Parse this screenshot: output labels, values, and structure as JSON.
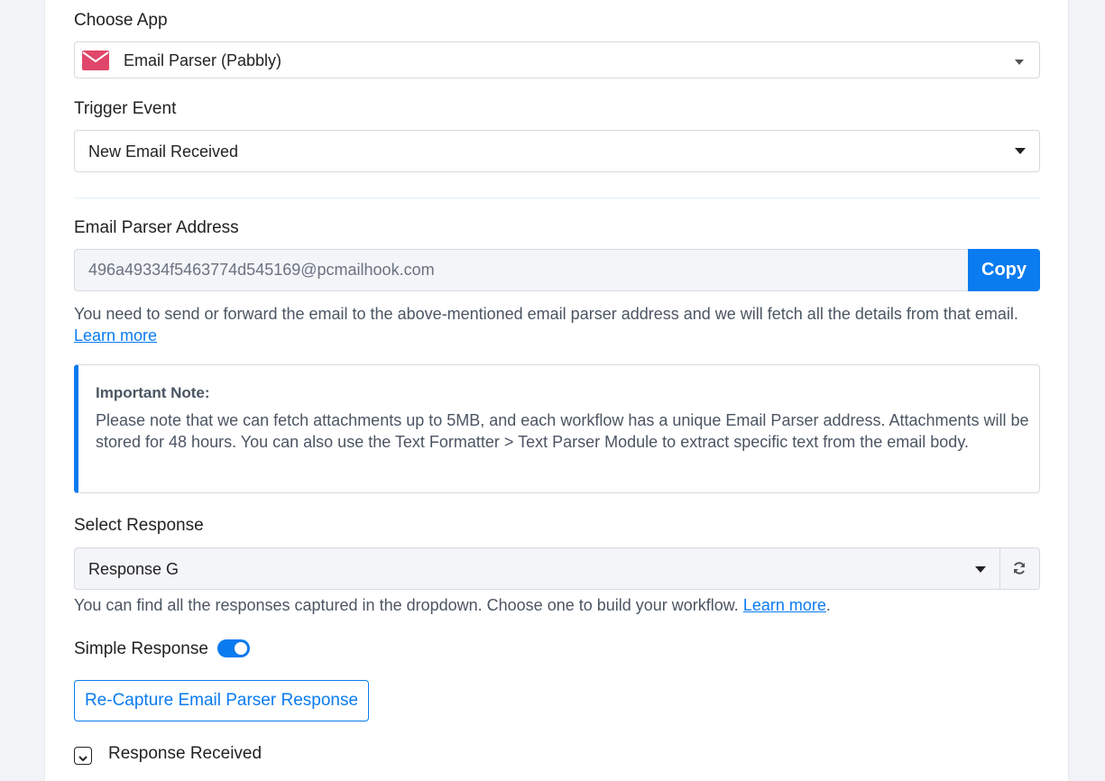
{
  "choose_app": {
    "label": "Choose App",
    "selected": "Email Parser (Pabbly)",
    "icon": "envelope-icon",
    "icon_color": "#e0476a"
  },
  "trigger_event": {
    "label": "Trigger Event",
    "selected": "New Email Received"
  },
  "email_parser_address": {
    "label": "Email Parser Address",
    "value": "496a49334f5463774d545169@pcmailhook.com",
    "copy_label": "Copy",
    "help_text": "You need to send or forward the email to the above-mentioned email parser address and we will fetch all the details from that email.",
    "learn_more": "Learn more"
  },
  "important_note": {
    "title": "Important Note:",
    "body": "Please note that we can fetch attachments up to 5MB, and each workflow has a unique Email Parser address. Attachments will be stored for 48 hours. You can also use the Text Formatter > Text Parser Module to extract specific text from the email body."
  },
  "select_response": {
    "label": "Select Response",
    "selected": "Response G",
    "help_text": "You can find all the responses captured in the dropdown. Choose one to build your workflow.",
    "learn_more": "Learn more",
    "help_suffix": "."
  },
  "simple_response": {
    "label": "Simple Response",
    "enabled": true
  },
  "recapture_button": "Re-Capture Email Parser Response",
  "response_received": "Response Received",
  "colors": {
    "accent": "#0b7bf0",
    "border": "#d6d9de"
  }
}
